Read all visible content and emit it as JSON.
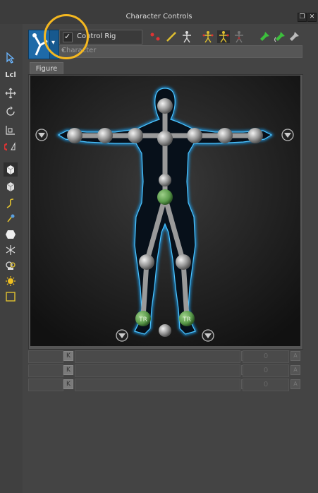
{
  "window": {
    "title": "Character Controls",
    "restore_symbol": "❐",
    "close_symbol": "✕"
  },
  "left_toolbar": {
    "tools": [
      {
        "name": "select-arrow-icon"
      },
      {
        "name": "local-icon",
        "label": "Lcl"
      },
      {
        "name": "move-icon"
      },
      {
        "name": "rotate-icon"
      },
      {
        "name": "scale-icon"
      },
      {
        "name": "magnet-icon"
      },
      {
        "name": "view-cube-icon"
      },
      {
        "name": "cube-icon"
      },
      {
        "name": "curve-icon"
      },
      {
        "name": "pen-icon"
      },
      {
        "name": "hexagon-icon"
      },
      {
        "name": "joint-icon"
      },
      {
        "name": "camera-icon"
      },
      {
        "name": "light-icon"
      },
      {
        "name": "bounding-box-icon"
      }
    ]
  },
  "header": {
    "control_rig_label": "Control Rig",
    "control_rig_checked": true,
    "character_select_value": "Character",
    "dropdown_symbol": "▾",
    "checkmark_symbol": "✓"
  },
  "tabs": {
    "figure_label": "Figure"
  },
  "figure": {
    "ik_left_foot_label": "TR",
    "ik_right_foot_label": "TR"
  },
  "rows": [
    {
      "k_label": "K",
      "value": "0",
      "a_label": "A"
    },
    {
      "k_label": "K",
      "value": "0",
      "a_label": "A"
    },
    {
      "k_label": "K",
      "value": "0",
      "a_label": "A"
    }
  ],
  "colors": {
    "background": "#444444",
    "accent_highlight": "#f5b820",
    "body_glow": "#1aa8ff",
    "green_effector": "#5a9a4a"
  }
}
